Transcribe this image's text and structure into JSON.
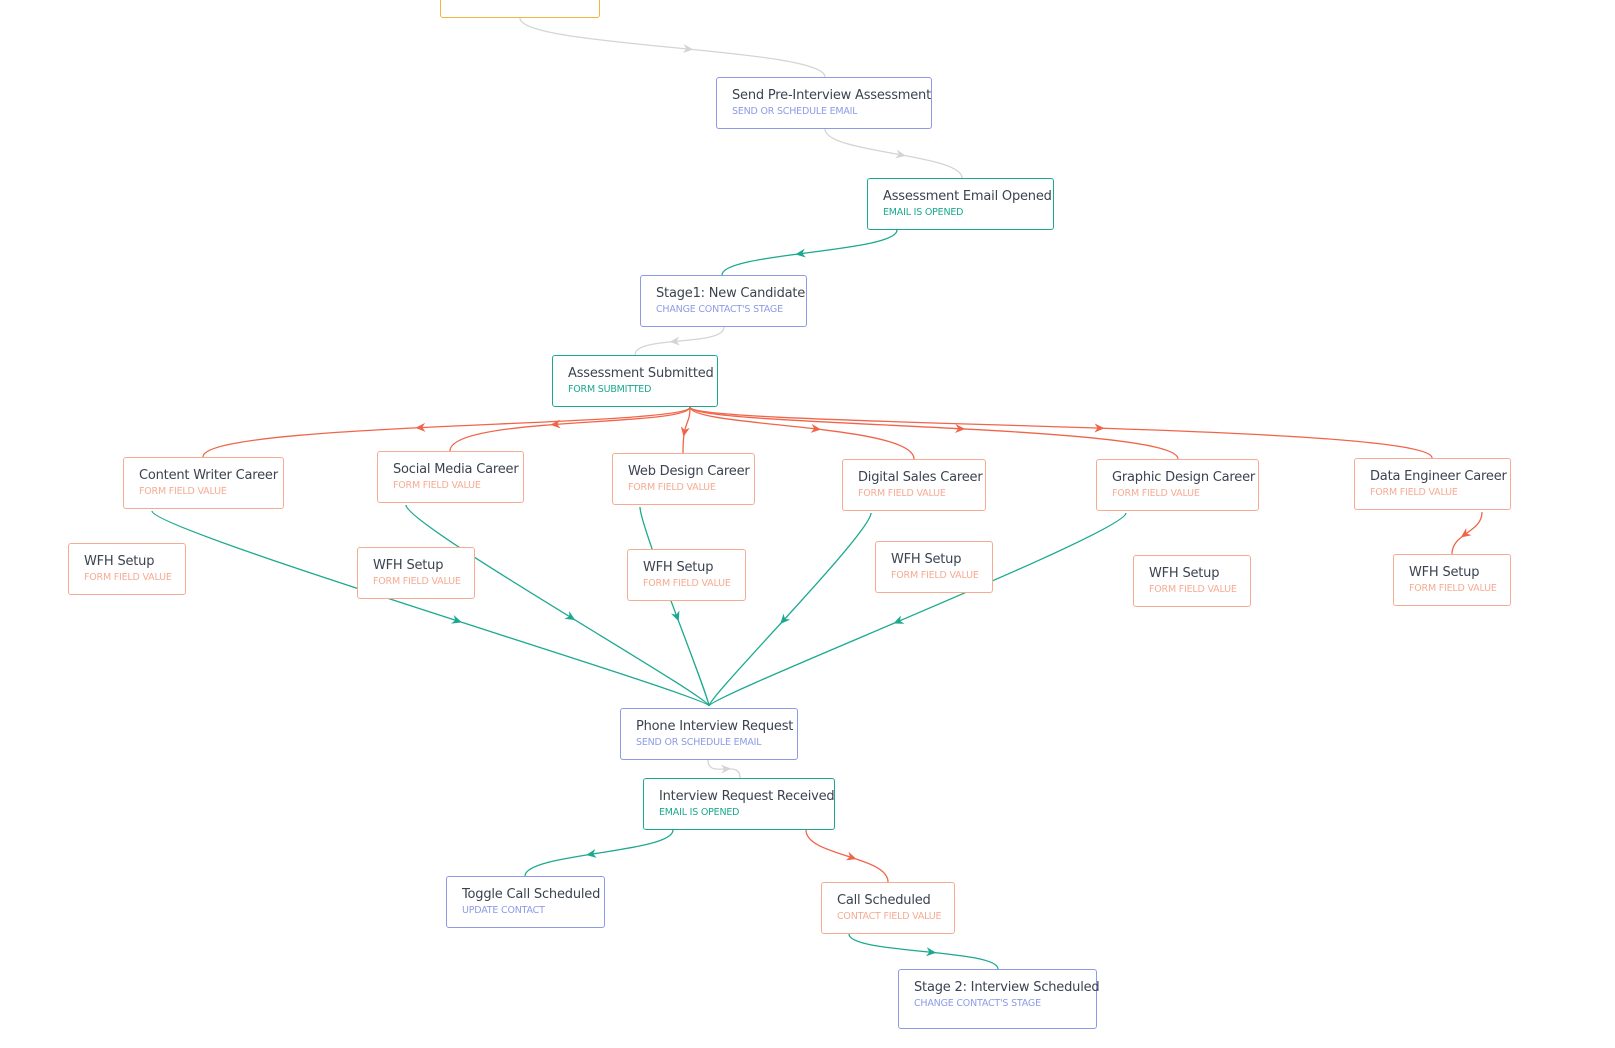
{
  "colors": {
    "action": "#8d9be6",
    "event": "#1aa98f",
    "condition": "#f6ab93",
    "start": "#f3b640",
    "edge_default": "#d4d4d4",
    "edge_yes": "#1aa98f",
    "edge_no": "#f0654a"
  },
  "nodes": {
    "start": {
      "title": "",
      "type": ""
    },
    "send_pre_interview": {
      "title": "Send Pre-Interview Assessment",
      "type": "Send or schedule email"
    },
    "assessment_email_opened": {
      "title": "Assessment Email Opened",
      "type": "Email is opened"
    },
    "stage1": {
      "title": "Stage1: New Candidate",
      "type": "Change contact's stage"
    },
    "assessment_submitted": {
      "title": "Assessment Submitted",
      "type": "Form submitted"
    },
    "content_writer": {
      "title": "Content Writer Career",
      "type": "Form field value"
    },
    "social_media": {
      "title": "Social Media Career",
      "type": "Form field value"
    },
    "web_design": {
      "title": "Web Design Career",
      "type": "Form field value"
    },
    "digital_sales": {
      "title": "Digital Sales Career",
      "type": "Form field value"
    },
    "graphic_design": {
      "title": "Graphic Design Career",
      "type": "Form field value"
    },
    "data_engineer": {
      "title": "Data Engineer Career",
      "type": "Form field value"
    },
    "wfh_1": {
      "title": "WFH Setup",
      "type": "Form field value"
    },
    "wfh_2": {
      "title": "WFH Setup",
      "type": "Form field value"
    },
    "wfh_3": {
      "title": "WFH Setup",
      "type": "Form field value"
    },
    "wfh_4": {
      "title": "WFH Setup",
      "type": "Form field value"
    },
    "wfh_5": {
      "title": "WFH Setup",
      "type": "Form field value"
    },
    "wfh_6": {
      "title": "WFH Setup",
      "type": "Form field value"
    },
    "phone_interview": {
      "title": "Phone Interview Request",
      "type": "Send or schedule email"
    },
    "interview_received": {
      "title": "Interview Request Received",
      "type": "Email is opened"
    },
    "toggle_call": {
      "title": "Toggle Call Scheduled",
      "type": "Update contact"
    },
    "call_scheduled": {
      "title": "Call Scheduled",
      "type": "Contact field value"
    },
    "stage2": {
      "title": "Stage 2: Interview Scheduled",
      "type": "Change contact's stage"
    }
  },
  "edges": [
    {
      "from": "start",
      "to": "send_pre_interview",
      "kind": "default"
    },
    {
      "from": "send_pre_interview",
      "to": "assessment_email_opened",
      "kind": "default"
    },
    {
      "from": "assessment_email_opened",
      "to": "stage1",
      "kind": "yes"
    },
    {
      "from": "stage1",
      "to": "assessment_submitted",
      "kind": "default"
    },
    {
      "from": "assessment_submitted",
      "to": "content_writer",
      "kind": "no"
    },
    {
      "from": "assessment_submitted",
      "to": "social_media",
      "kind": "no"
    },
    {
      "from": "assessment_submitted",
      "to": "web_design",
      "kind": "no"
    },
    {
      "from": "assessment_submitted",
      "to": "digital_sales",
      "kind": "no"
    },
    {
      "from": "assessment_submitted",
      "to": "graphic_design",
      "kind": "no"
    },
    {
      "from": "assessment_submitted",
      "to": "data_engineer",
      "kind": "no"
    },
    {
      "from": "content_writer",
      "to": "phone_interview",
      "kind": "yes"
    },
    {
      "from": "social_media",
      "to": "phone_interview",
      "kind": "yes"
    },
    {
      "from": "web_design",
      "to": "phone_interview",
      "kind": "yes"
    },
    {
      "from": "digital_sales",
      "to": "phone_interview",
      "kind": "yes"
    },
    {
      "from": "graphic_design",
      "to": "phone_interview",
      "kind": "yes"
    },
    {
      "from": "data_engineer",
      "to": "wfh_6",
      "kind": "no"
    },
    {
      "from": "phone_interview",
      "to": "interview_received",
      "kind": "default"
    },
    {
      "from": "interview_received",
      "to": "toggle_call",
      "kind": "yes"
    },
    {
      "from": "interview_received",
      "to": "call_scheduled",
      "kind": "no"
    },
    {
      "from": "call_scheduled",
      "to": "stage2",
      "kind": "yes"
    }
  ]
}
